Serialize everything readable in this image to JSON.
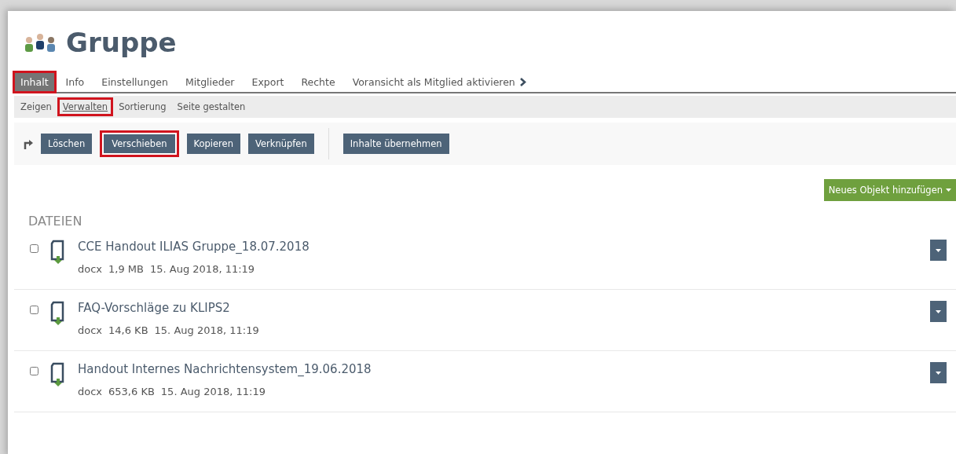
{
  "title": "Gruppe",
  "tabs": [
    {
      "label": "Inhalt",
      "selected": true,
      "highlighted": true
    },
    {
      "label": "Info",
      "selected": false,
      "highlighted": false
    },
    {
      "label": "Einstellungen",
      "selected": false,
      "highlighted": false
    },
    {
      "label": "Mitglieder",
      "selected": false,
      "highlighted": false
    },
    {
      "label": "Export",
      "selected": false,
      "highlighted": false
    },
    {
      "label": "Rechte",
      "selected": false,
      "highlighted": false
    },
    {
      "label": "Voransicht als Mitglied aktivieren",
      "selected": false,
      "highlighted": false,
      "kind": "action"
    }
  ],
  "subtabs": [
    {
      "label": "Zeigen",
      "selected": false,
      "highlighted": false
    },
    {
      "label": "Verwalten",
      "selected": true,
      "highlighted": true
    },
    {
      "label": "Sortierung",
      "selected": false,
      "highlighted": false
    },
    {
      "label": "Seite gestalten",
      "selected": false,
      "highlighted": false
    }
  ],
  "toolbar": {
    "buttons": [
      {
        "label": "Löschen",
        "highlighted": false
      },
      {
        "label": "Verschieben",
        "highlighted": true
      },
      {
        "label": "Kopieren",
        "highlighted": false
      },
      {
        "label": "Verknüpfen",
        "highlighted": false
      }
    ],
    "extra_button": "Inhalte übernehmen"
  },
  "add_button": "Neues Objekt hinzufügen",
  "section_title": "DATEIEN",
  "files": [
    {
      "name": "CCE Handout ILIAS Gruppe_18.07.2018",
      "type": "docx",
      "size": "1,9 MB",
      "date": "15. Aug 2018, 11:19",
      "checked": false
    },
    {
      "name": "FAQ-Vorschläge zu KLIPS2",
      "type": "docx",
      "size": "14,6 KB",
      "date": "15. Aug 2018, 11:19",
      "checked": false
    },
    {
      "name": "Handout Internes Nachrichtensystem_19.06.2018",
      "type": "docx",
      "size": "653,6 KB",
      "date": "15. Aug 2018, 11:19",
      "checked": false
    }
  ]
}
